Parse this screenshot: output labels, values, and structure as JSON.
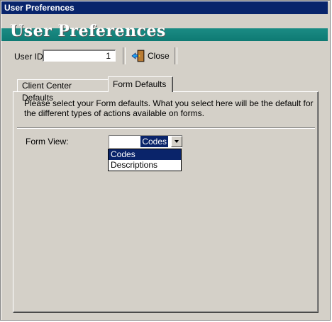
{
  "window": {
    "title": "User Preferences"
  },
  "header": {
    "title": "User Preferences"
  },
  "toolbar": {
    "userid_label": "User ID:",
    "userid_value": "1",
    "close_label": "Close"
  },
  "tabs": [
    {
      "label": "Client Center Defaults",
      "active": false
    },
    {
      "label": "Form Defaults",
      "active": true
    }
  ],
  "panel": {
    "description": "Please select your Form defaults.  What you select here will be the default for the different types of actions available on forms.",
    "formview_label": "Form View:",
    "formview_value": "Codes",
    "options": [
      "Codes",
      "Descriptions"
    ],
    "selected_option": "Codes"
  },
  "colors": {
    "title_bar": "#08246b",
    "header_band": "#1b8c84",
    "selection": "#0a246a",
    "face": "#d4d0c8"
  }
}
